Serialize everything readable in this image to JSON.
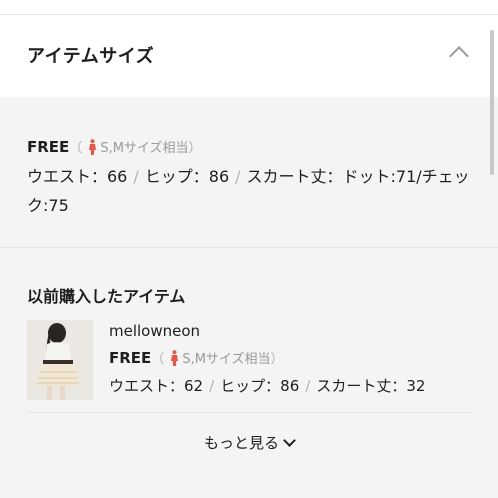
{
  "section": {
    "title": "アイテムサイズ"
  },
  "size": {
    "label": "FREE",
    "paren_open": "（",
    "equivalent": "S,Mサイズ相当",
    "paren_close": "）",
    "waist": "ウエスト：66",
    "hip": "ヒップ：86",
    "skirt": "スカート丈：ドット:71/チェック:75"
  },
  "previous": {
    "title": "以前購入したアイテム",
    "items": [
      {
        "brand": "mellowneon",
        "size_label": "FREE",
        "paren_open": "（",
        "equivalent": "S,Mサイズ相当",
        "paren_close": "）",
        "waist": "ウエスト：62",
        "hip": "ヒップ：86",
        "skirt": "スカート丈：32"
      }
    ]
  },
  "more_label": "もっと見る",
  "icons": [
    "chevron-up-icon",
    "person-icon",
    "chevron-down-icon"
  ],
  "colors": {
    "person_icon": "#e05a4a",
    "background": "#f4f4f4"
  }
}
